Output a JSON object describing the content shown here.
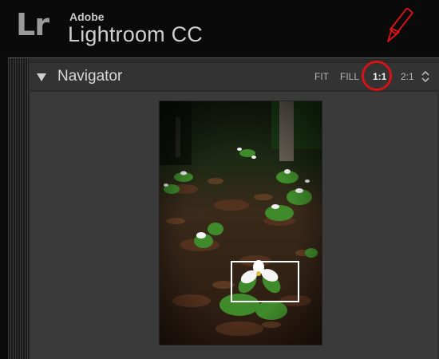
{
  "brand": {
    "logo_text": "Lr",
    "company": "Adobe",
    "product": "Lightroom CC"
  },
  "navigator": {
    "title": "Navigator",
    "zoom_options": [
      {
        "label": "FIT",
        "active": false
      },
      {
        "label": "FILL",
        "active": false
      },
      {
        "label": "1:1",
        "active": true
      },
      {
        "label": "2:1",
        "active": false
      }
    ]
  },
  "annotation": {
    "color": "#d61216",
    "highlighted_option": "1:1"
  },
  "colors": {
    "background": "#0b0b0b",
    "panel": "#2f2f2f",
    "panel_header": "#333333",
    "preview_background": "#3a3a3a",
    "text": "#d8d8d8"
  }
}
